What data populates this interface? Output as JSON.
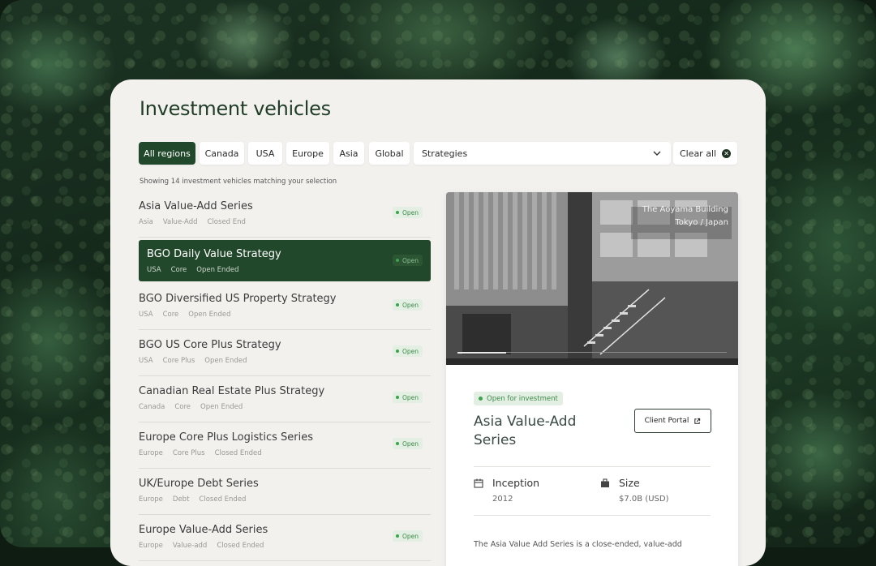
{
  "page": {
    "title": "Investment vehicles",
    "results_text": "Showing 14 investment vehicles matching your selection"
  },
  "filters": {
    "regions": [
      "All regions",
      "Canada",
      "USA",
      "Europe",
      "Asia",
      "Global"
    ],
    "active_region": "All regions",
    "strategies_label": "Strategies",
    "clear_label": "Clear all"
  },
  "vehicles": [
    {
      "name": "Asia Value-Add Series",
      "tags": [
        "Asia",
        "Value-Add",
        "Closed End"
      ],
      "status": "Open",
      "selected": false
    },
    {
      "name": "BGO Daily Value Strategy",
      "tags": [
        "USA",
        "Core",
        "Open Ended"
      ],
      "status": "Open",
      "selected": true
    },
    {
      "name": "BGO Diversified US Property Strategy",
      "tags": [
        "USA",
        "Core",
        "Open Ended"
      ],
      "status": "Open",
      "selected": false
    },
    {
      "name": "BGO US Core Plus Strategy",
      "tags": [
        "USA",
        "Core Plus",
        "Open Ended"
      ],
      "status": "Open",
      "selected": false
    },
    {
      "name": "Canadian Real Estate Plus Strategy",
      "tags": [
        "Canada",
        "Core",
        "Open Ended"
      ],
      "status": "Open",
      "selected": false
    },
    {
      "name": "Europe Core Plus Logistics Series",
      "tags": [
        "Europe",
        "Core Plus",
        "Closed Ended"
      ],
      "status": "Open",
      "selected": false
    },
    {
      "name": "UK/Europe Debt Series",
      "tags": [
        "Europe",
        "Debt",
        "Closed Ended"
      ],
      "status": "",
      "selected": false
    },
    {
      "name": "Europe Value-Add Series",
      "tags": [
        "Europe",
        "Value-add",
        "Closed Ended"
      ],
      "status": "Open",
      "selected": false
    }
  ],
  "detail": {
    "photo_caption_line1": "The Aoyama Building",
    "photo_caption_line2": "Tokyo / Japan",
    "status": "Open for investment",
    "title": "Asia Value-Add Series",
    "portal_label": "Client Portal",
    "inception_label": "Inception",
    "inception_value": "2012",
    "size_label": "Size",
    "size_value": "$7.0B (USD)",
    "description": "The Asia Value Add Series is a close-ended, value-add"
  },
  "colors": {
    "brand_green": "#22482b",
    "open_green": "#3ba34d",
    "panel_bg": "#f3f1ee"
  },
  "icons": {
    "filter_dropdown": "chevron-down-icon",
    "clear": "close-circle-icon",
    "external_link": "external-link-icon",
    "inception": "calendar-icon",
    "size": "briefcase-icon"
  }
}
